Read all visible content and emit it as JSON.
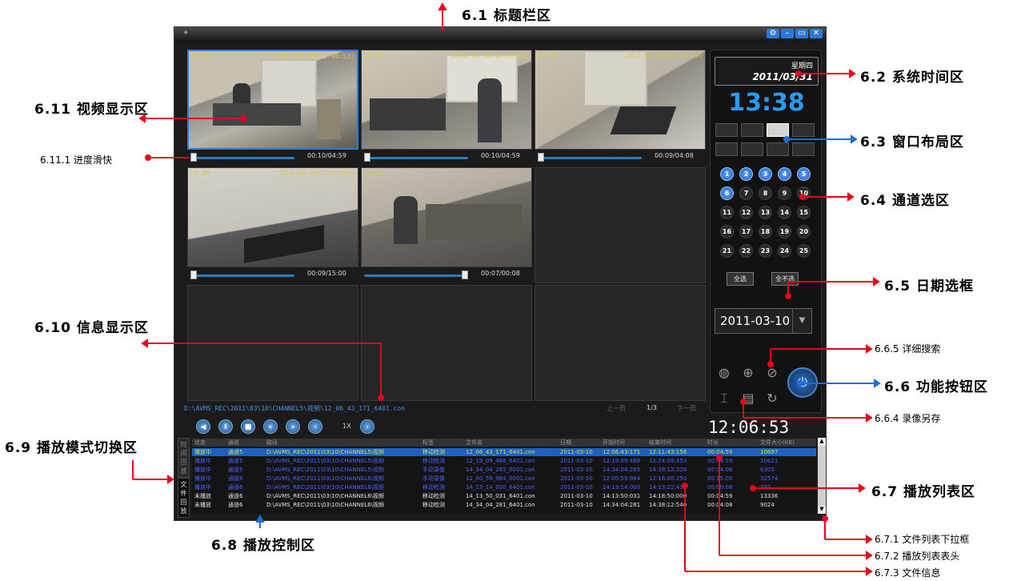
{
  "annotations": {
    "a61": "6.1 标题栏区",
    "a62": "6.2 系统时间区",
    "a63": "6.3 窗口布局区",
    "a64": "6.4 通道选区",
    "a65": "6.5 日期选框",
    "a66": "6.6 功能按钮区",
    "a665": "6.6.5 详细搜索",
    "a664": "6.6.4 录像另存",
    "a67": "6.7 播放列表区",
    "a671": "6.7.1 文件列表下拉框",
    "a672": "6.7.2 播放列表表头",
    "a673": "6.7.3 文件信息",
    "a68": "6.8 播放控制区",
    "a69": "6.9 播放模式切换区",
    "a610": "6.10 信息显示区",
    "a611": "6.11 视频显示区",
    "a6111": "6.11.1 进度滑快"
  },
  "sys": {
    "weekday": "星期四",
    "date": "2011/03/31",
    "clock": "13:38"
  },
  "cams": [
    {
      "label": "CH 05",
      "ts": "2011-03-10(12:06:53)",
      "time": "00:10/04:59",
      "progress": 0.02
    },
    {
      "label": "CH 05",
      "ts": "2011-03-10(12:19:19)",
      "time": "00:10/04:59",
      "progress": 0.02
    },
    {
      "label": "CH 06",
      "ts": "2011-03-10(14:34:15)",
      "time": "00:09/04:08",
      "progress": 0.02
    },
    {
      "label": "CH 06",
      "ts": "2011-03-10(12:01:06)",
      "time": "00:09/15:00",
      "progress": 0.01
    },
    {
      "label": "CH 06",
      "ts": "",
      "time": "00:07/00:08",
      "progress": 0.97
    }
  ],
  "channels": [
    "1",
    "2",
    "3",
    "4",
    "5",
    "6",
    "7",
    "8",
    "9",
    "10",
    "11",
    "12",
    "13",
    "14",
    "15",
    "16",
    "17",
    "18",
    "19",
    "20",
    "21",
    "22",
    "23",
    "24",
    "25"
  ],
  "panel": {
    "sel_all": "全选",
    "desel_all": "全不选",
    "date": "2011-03-10"
  },
  "info": {
    "path": "D:\\AVMS_REC\\2011\\03\\10\\CHANNEL5\\视频\\12_06_43_171_6401.con",
    "prev": "上一页",
    "page": "1/3",
    "next": "下一页"
  },
  "playback": {
    "speed": "1X",
    "bigtime": "12:06:53"
  },
  "modes": [
    "时间回放",
    "文件回放"
  ],
  "table": {
    "headers": [
      "状态",
      "通道",
      "路径",
      "标签",
      "文件名",
      "日期",
      "开始时间",
      "结束时间",
      "时长",
      "文件大小(KB)"
    ],
    "rows": [
      [
        "播放中",
        "通道5",
        "D:\\AVMS_REC\\2011\\03\\10\\CHANNEL5\\视频",
        "移动检测",
        "12_06_43_171_6401.con",
        "2011-03-10",
        "12:06:43:171",
        "12:11:43:156",
        "00:04:59",
        "10697"
      ],
      [
        "播放中",
        "通道5",
        "D:\\AVMS_REC\\2011\\03\\10\\CHANNEL5\\视频",
        "移动检测",
        "12_19_09_468_6401.con",
        "2011-03-10",
        "12:19:09:468",
        "12:24:09:453",
        "00:04:59",
        "10621"
      ],
      [
        "播放中",
        "通道5",
        "D:\\AVMS_REC\\2011\\03\\10\\CHANNEL5\\视频",
        "手动录像",
        "14_34_04_265_0001.con",
        "2011-03-10",
        "14:34:04:265",
        "14:38:12:328",
        "00:04:08",
        "6303"
      ],
      [
        "播放中",
        "通道6",
        "D:\\AVMS_REC\\2011\\03\\10\\CHANNEL6\\视频",
        "手动录像",
        "12_00_59_984_0001.con",
        "2011-03-10",
        "12:00:59:984",
        "12:16:00:250",
        "00:15:00",
        "32574"
      ],
      [
        "播放中",
        "通道6",
        "D:\\AVMS_REC\\2011\\03\\10\\CHANNEL6\\视频",
        "移动检测",
        "14_13_14_000_6401.con",
        "2011-03-10",
        "14:13:14:000",
        "14:13:22:437",
        "00:00:08",
        "292"
      ],
      [
        "未播放",
        "通道6",
        "D:\\AVMS_REC\\2011\\03\\10\\CHANNEL6\\视频",
        "移动检测",
        "14_13_50_031_6401.con",
        "2011-03-10",
        "14:13:50:031",
        "14:18:50:000",
        "00:04:59",
        "13336"
      ],
      [
        "未播放",
        "通道6",
        "D:\\AVMS_REC\\2011\\03\\10\\CHANNEL6\\视频",
        "移动检测",
        "14_34_04_281_6401.con",
        "2011-03-10",
        "14:34:04:281",
        "14:38:12:540",
        "00:04:08",
        "9024"
      ]
    ]
  },
  "colors": {
    "accent": "#2a9bf0",
    "annotation_red": "#e8001c",
    "annotation_blue": "#1d6fd0"
  }
}
